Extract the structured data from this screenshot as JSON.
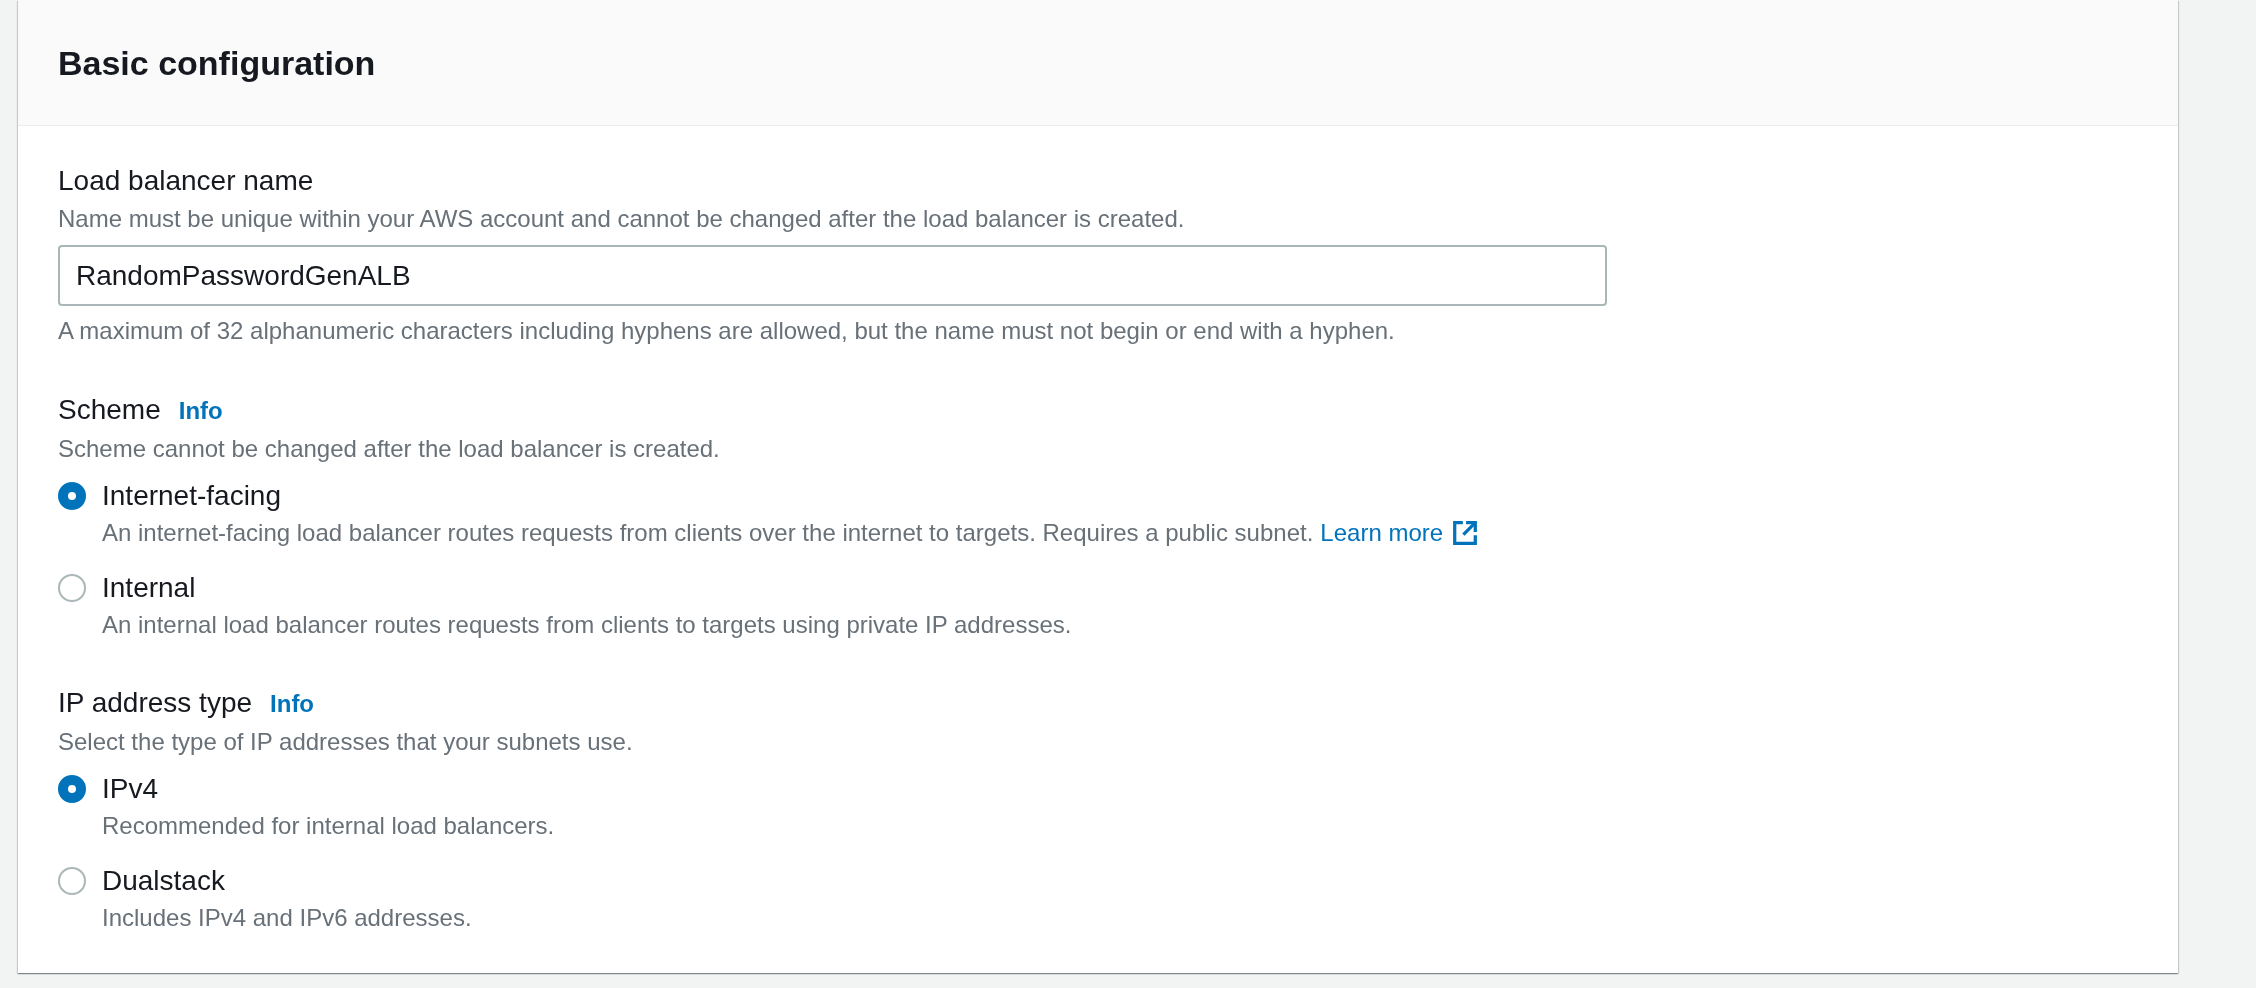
{
  "section": {
    "title": "Basic configuration"
  },
  "fields": [
    {
      "kind": "text",
      "label": "Load balancer name",
      "description": "Name must be unique within your AWS account and cannot be changed after the load balancer is created.",
      "value": "RandomPasswordGenALB",
      "constraint": "A maximum of 32 alphanumeric characters including hyphens are allowed, but the name must not begin or end with a hyphen."
    },
    {
      "kind": "radio",
      "label": "Scheme",
      "info": "Info",
      "description": "Scheme cannot be changed after the load balancer is created.",
      "options": [
        {
          "label": "Internet-facing",
          "description": "An internet-facing load balancer routes requests from clients over the internet to targets. Requires a public subnet.",
          "link": "Learn more",
          "selected": true
        },
        {
          "label": "Internal",
          "description": "An internal load balancer routes requests from clients to targets using private IP addresses.",
          "selected": false
        }
      ]
    },
    {
      "kind": "radio",
      "label": "IP address type",
      "info": "Info",
      "description": "Select the type of IP addresses that your subnets use.",
      "options": [
        {
          "label": "IPv4",
          "description": "Recommended for internal load balancers.",
          "selected": true
        },
        {
          "label": "Dualstack",
          "description": "Includes IPv4 and IPv6 addresses.",
          "selected": false
        }
      ]
    }
  ]
}
